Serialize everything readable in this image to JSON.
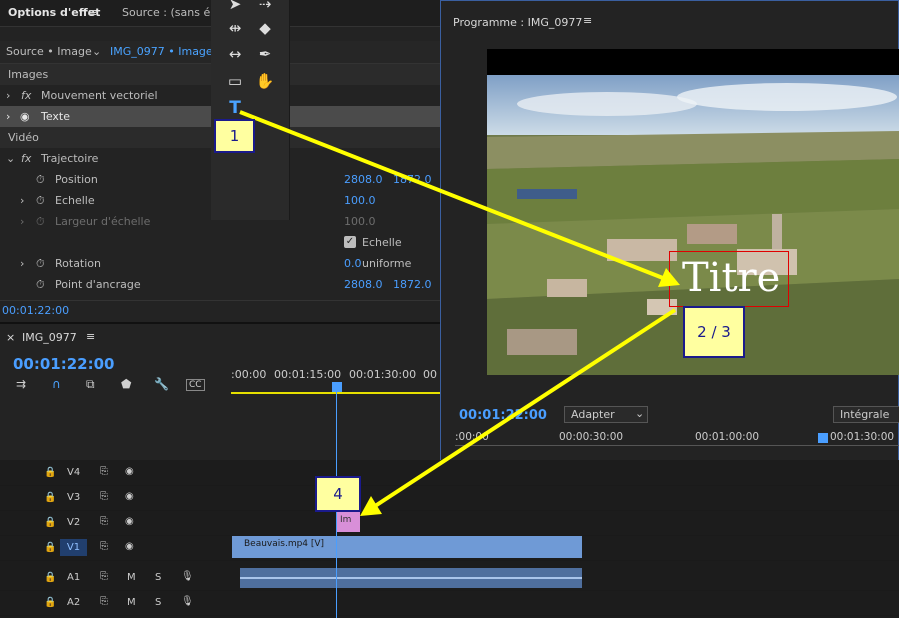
{
  "effects": {
    "tab_effects": "Options d'effet",
    "tab_source": "Source : (sans élé",
    "source_label": "Source • Image",
    "clip_label": "IMG_0977 • Image",
    "section_images": "Images",
    "vector_motion": "Mouvement vectoriel",
    "text_layer": "Texte",
    "section_video": "Vidéo",
    "trajectory": "Trajectoire",
    "position_label": "Position",
    "position_x": "2808.0",
    "position_y": "1872.0",
    "scale_label": "Echelle",
    "scale_value": "100.0",
    "scale_width_label": "Largeur d'échelle",
    "scale_width_value": "100.0",
    "uniform_label": "Echelle uniforme",
    "rotation_label": "Rotation",
    "rotation_value": "0.0",
    "anchor_label": "Point d'ancrage",
    "anchor_x": "2808.0",
    "anchor_y": "1872.0",
    "timecode": "00:01:22:00"
  },
  "program": {
    "title": "Programme : IMG_0977",
    "title_overlay": "Titre",
    "timecode": "00:01:22:00",
    "fit_label": "Adapter",
    "quality_label": "Intégrale",
    "ruler": ":00:00",
    "ruler_1": "00:00:30:00",
    "ruler_2": "00:01:00:00",
    "ruler_3": "00:01:30:00"
  },
  "timeline": {
    "title": "IMG_0977",
    "timecode": "00:01:22:00",
    "ruler_0": ":00:00",
    "ruler_1": "00:01:15:00",
    "ruler_2": "00:01:30:00",
    "ruler_3": "00",
    "tracks": {
      "v4": "V4",
      "v3": "V3",
      "v2": "V2",
      "v1": "V1",
      "a1": "A1",
      "a2": "A2",
      "m": "M",
      "s": "S"
    },
    "clip_video": "Beauvais.mp4 [V]",
    "clip_graphic": "Im"
  },
  "callouts": {
    "c1": "1",
    "c23": "2 / 3",
    "c4": "4"
  },
  "colors": {
    "accent": "#4a9eff",
    "callout_bg": "#ffffa0",
    "callout_border": "#1a1a8c",
    "arrow": "#ffff00",
    "clip": "#7aa0d4"
  }
}
